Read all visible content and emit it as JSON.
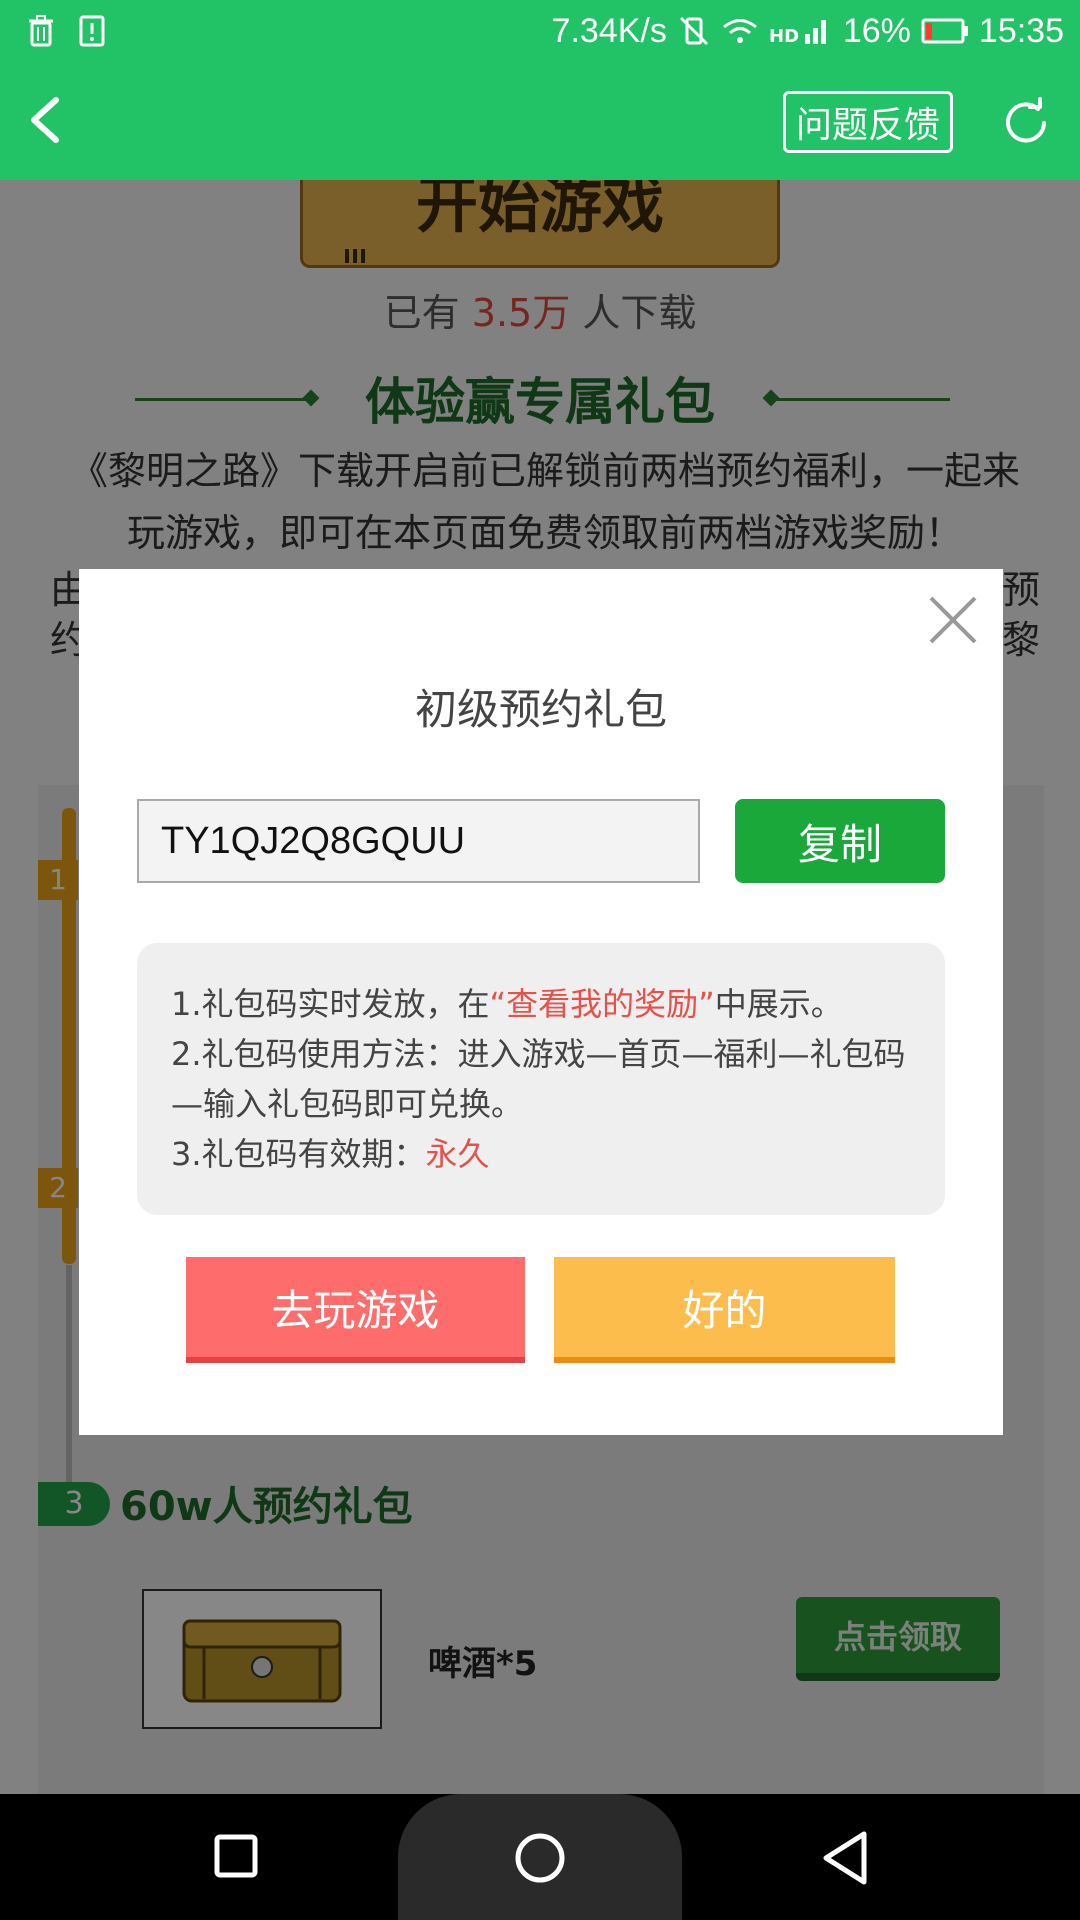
{
  "status_bar": {
    "network_speed": "7.34K/s",
    "battery": "16%",
    "time": "15:35",
    "icons": [
      "trash-icon",
      "alert-icon",
      "vibrate-off-icon",
      "wifi-icon",
      "hd-signal-icon",
      "battery-icon"
    ]
  },
  "header": {
    "feedback_label": "问题反馈",
    "back_icon": "back-arrow-icon",
    "refresh_icon": "refresh-icon"
  },
  "page": {
    "start_button_label": "开始游戏",
    "download": {
      "prefix": "已有",
      "count": "3.5万",
      "suffix": "人下载"
    },
    "section_title": "体验赢专属礼包",
    "intro": "《黎明之路》下载开启前已解锁前两档预约福利，一起来玩游戏，即可在本页面免费领取前两档游戏奖励！",
    "intro_extra_line1_start": "由",
    "intro_extra_line1_end": "预",
    "intro_extra_line2_start": "约",
    "intro_extra_line2_end": "黎",
    "steps": {
      "step1": "1",
      "step2": "2",
      "step3": "3",
      "step3_title": "60w人预约礼包"
    },
    "reward": {
      "name": "啤酒*5",
      "claim_label": "点击领取"
    }
  },
  "modal": {
    "title": "初级预约礼包",
    "code_value": "TY1QJ2Q8GQUU",
    "copy_label": "复制",
    "notes": {
      "line1_prefix": "1.礼包码实时发放，在",
      "line1_highlight": "“查看我的奖励”",
      "line1_suffix": "中展示。",
      "line2": "2.礼包码使用方法：进入游戏—首页—福利—礼包码—输入礼包码即可兑换。",
      "line3_prefix": "3.礼包码有效期：",
      "line3_highlight": "永久"
    },
    "play_label": "去玩游戏",
    "ok_label": "好的"
  },
  "colors": {
    "brand_green": "#22c266",
    "copy_green": "#1aa83a",
    "play_red": "#fe6c6c",
    "ok_orange": "#fdbd4c",
    "highlight_red": "#e8504a"
  }
}
